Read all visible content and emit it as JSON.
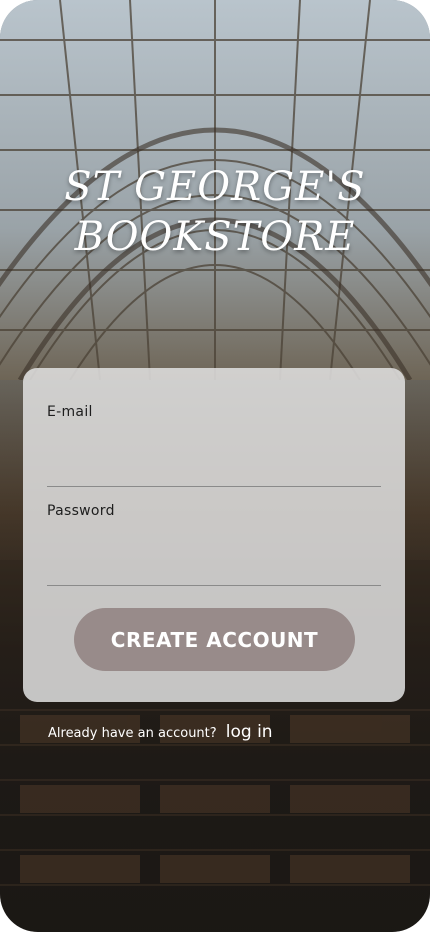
{
  "app": {
    "title_line1": "ST GEORGE'S",
    "title_line2": "BOOKSTORE"
  },
  "form": {
    "email_label": "E-mail",
    "email_value": "",
    "password_label": "Password",
    "password_value": "",
    "create_button_label": "CREATE ACCOUNT"
  },
  "footer": {
    "prompt": "Already have an account?",
    "login_link": "log in"
  },
  "colors": {
    "button": "#988b8a",
    "card": "#e1e1e1",
    "text_light": "#ffffff"
  },
  "background": {
    "scene": "library-hall-photo"
  }
}
